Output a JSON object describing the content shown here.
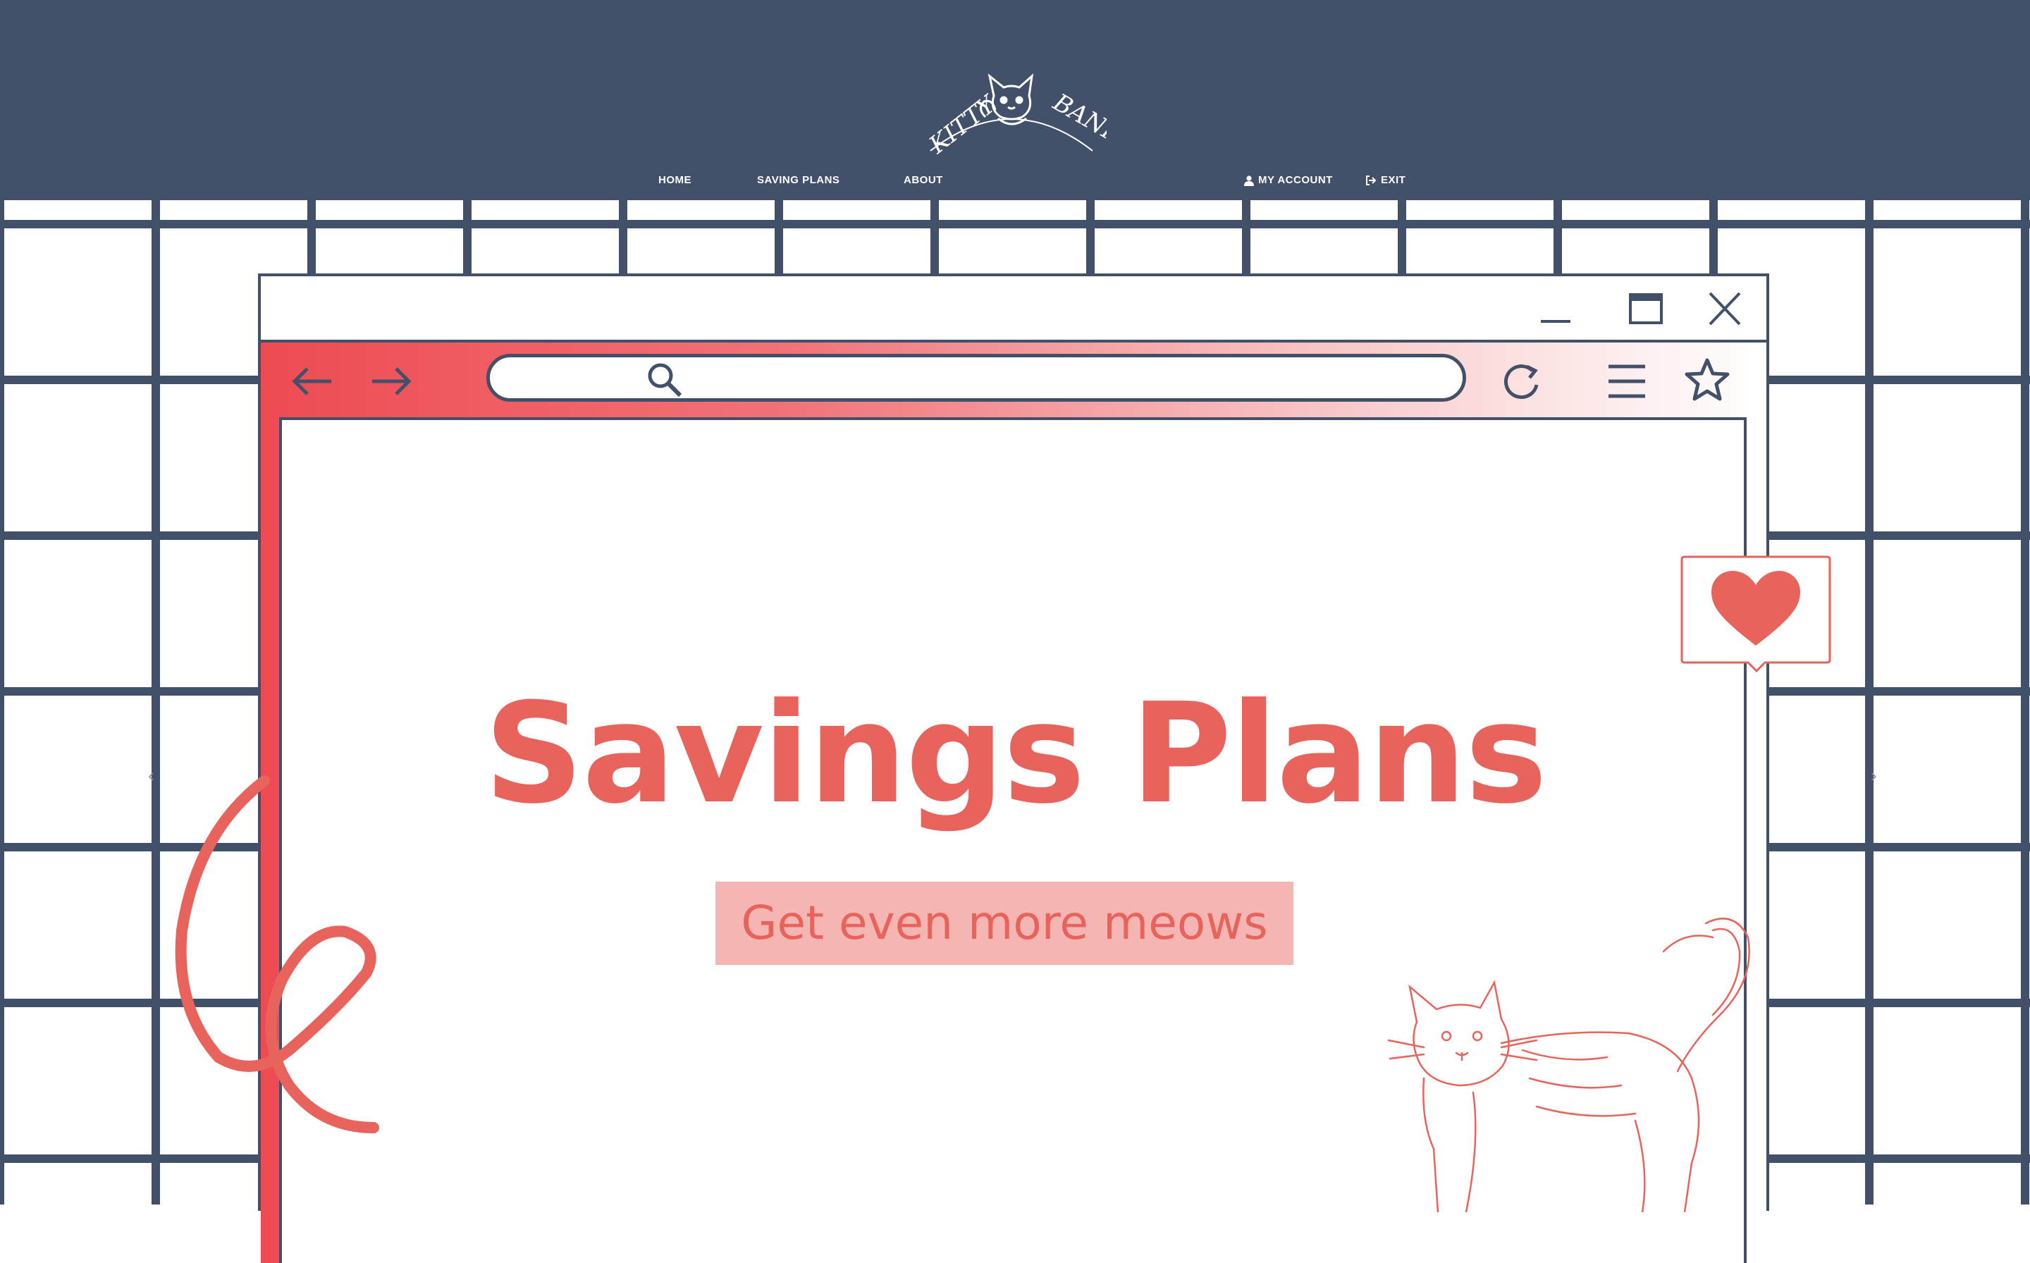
{
  "brand": {
    "logo_text_left": "KITTY",
    "logo_text_right": "BANK"
  },
  "nav": {
    "home": "HOME",
    "saving_plans": "SAVING PLANS",
    "about": "ABOUT",
    "my_account": "MY ACCOUNT",
    "exit": "EXIT"
  },
  "browser": {
    "url_value": "",
    "icons": {
      "minimize": "minimize-icon",
      "maximize": "maximize-icon",
      "close": "close-icon",
      "back": "arrow-left-icon",
      "forward": "arrow-right-icon",
      "search": "search-icon",
      "reload": "reload-icon",
      "menu": "hamburger-icon",
      "bookmark": "star-icon"
    }
  },
  "hero": {
    "title": "Savings Plans",
    "subtitle": "Get even more meows"
  },
  "carousel": {
    "prev": "‹",
    "next": "›"
  },
  "colors": {
    "navy": "#435069",
    "coral": "#e8635c",
    "red": "#ee4b52",
    "pink": "#f5b6b3"
  }
}
